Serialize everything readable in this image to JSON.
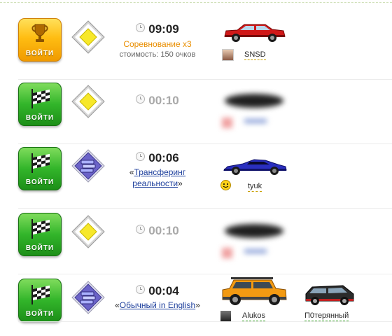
{
  "rows": [
    {
      "button": {
        "label": "ВОЙТИ",
        "icon": "trophy-icon",
        "color": "#f5a300"
      },
      "mode_icon": "road-sign-icon",
      "time": "09:09",
      "competition_name": "Соревнование",
      "multiplier": "x3",
      "cost": "стоимость: 150 очков",
      "players": [
        {
          "name": "SNSD",
          "car_color": "#d01818"
        }
      ]
    },
    {
      "button": {
        "label": "ВОЙТИ",
        "icon": "checkered-flag-icon",
        "color": "#2fae25"
      },
      "mode_icon": "road-sign-icon",
      "time": "00:10",
      "players": [
        {
          "name": "hidden"
        }
      ]
    },
    {
      "button": {
        "label": "ВОЙТИ",
        "icon": "checkered-flag-icon",
        "color": "#2fae25"
      },
      "mode_icon": "books-icon",
      "time": "00:06",
      "mode_line1": "Трансферинг",
      "mode_line2": "реальности",
      "players": [
        {
          "name": "tyuk",
          "car_color": "#2a2fbf"
        }
      ]
    },
    {
      "button": {
        "label": "ВОЙТИ",
        "icon": "checkered-flag-icon",
        "color": "#2fae25"
      },
      "mode_icon": "road-sign-icon",
      "time": "00:10",
      "players": [
        {
          "name": "hidden"
        }
      ]
    },
    {
      "button": {
        "label": "ВОЙТИ",
        "icon": "checkered-flag-icon",
        "color": "#2fae25"
      },
      "mode_icon": "books-icon",
      "time": "00:04",
      "mode_line1": "Обычный in English",
      "players": [
        {
          "name": "Alukos",
          "car_color": "#f39a12"
        },
        {
          "name": "П0терянный",
          "car_color": "#2b2b2b"
        }
      ]
    }
  ],
  "quote_open": "«",
  "quote_close": "»"
}
